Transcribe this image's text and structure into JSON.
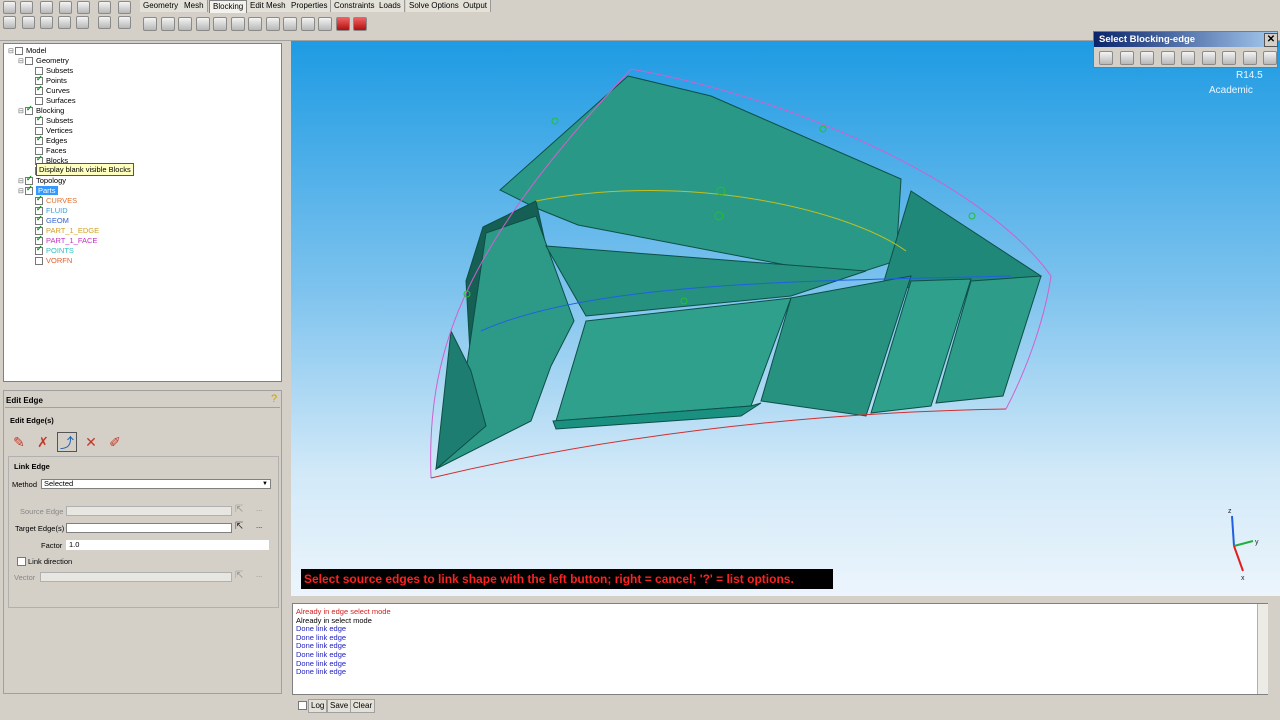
{
  "menu_tabs": [
    "Geometry",
    "Mesh",
    "Blocking",
    "Edit Mesh",
    "Properties",
    "Constraints",
    "Loads",
    "Solve Options",
    "Output"
  ],
  "active_tab": "Blocking",
  "tree": [
    {
      "label": "Model",
      "checked": false,
      "color": "#000000"
    },
    {
      "label": "Geometry",
      "checked": false,
      "color": "#000000"
    },
    {
      "label": "Subsets",
      "checked": false,
      "color": "#000000"
    },
    {
      "label": "Points",
      "checked": true,
      "color": "#000000"
    },
    {
      "label": "Curves",
      "checked": true,
      "color": "#000000"
    },
    {
      "label": "Surfaces",
      "checked": false,
      "color": "#000000"
    },
    {
      "label": "Blocking",
      "checked": true,
      "color": "#000000"
    },
    {
      "label": "Subsets",
      "checked": true,
      "color": "#000000"
    },
    {
      "label": "Vertices",
      "checked": false,
      "color": "#000000"
    },
    {
      "label": "Edges",
      "checked": true,
      "color": "#000000"
    },
    {
      "label": "Faces",
      "checked": false,
      "color": "#000000"
    },
    {
      "label": "Blocks",
      "checked": true,
      "color": "#000000"
    },
    {
      "label": "",
      "checked": false,
      "color": "#000000"
    },
    {
      "label": "Topology",
      "checked": true,
      "color": "#000000"
    },
    {
      "label": "Parts",
      "checked": true,
      "color": "#ffffff",
      "selected": true
    },
    {
      "label": "CURVES",
      "checked": true,
      "color": "#e07030"
    },
    {
      "label": "FLUID",
      "checked": true,
      "color": "#30a0e0"
    },
    {
      "label": "GEOM",
      "checked": true,
      "color": "#3060d0"
    },
    {
      "label": "PART_1_EDGE",
      "checked": true,
      "color": "#d0a020"
    },
    {
      "label": "PART_1_FACE",
      "checked": true,
      "color": "#c030c0"
    },
    {
      "label": "POINTS",
      "checked": true,
      "color": "#30c0c0"
    },
    {
      "label": "VORFN",
      "checked": false,
      "color": "#e06030"
    }
  ],
  "tooltip": "Display blank visible Blocks",
  "panel": {
    "title": "Edit Edge",
    "section": "Edit Edge(s)",
    "subsection": "Link Edge",
    "method_label": "Method",
    "method_value": "Selected",
    "source_label": "Source Edge",
    "target_label": "Target Edge(s)",
    "factor_label": "Factor",
    "factor_value": "1.0",
    "link_direction_label": "Link direction",
    "vector_label": "Vector",
    "dots": "..."
  },
  "select_dialog_title": "Select Blocking-edge",
  "version_label": "R14.5",
  "version_sub": "Academic",
  "status_message": "Select source edges to link shape with the left button; right = cancel; '?' = list options.",
  "log_lines": [
    {
      "text": "Already in edge select mode",
      "color": "#d02020"
    },
    {
      "text": "Already in select mode",
      "color": "#000000"
    },
    {
      "text": "Done link edge",
      "color": "#2020c0"
    },
    {
      "text": "Done link edge",
      "color": "#2020c0"
    },
    {
      "text": "Done link edge",
      "color": "#2020c0"
    },
    {
      "text": "Done link edge",
      "color": "#2020c0"
    },
    {
      "text": "Done link edge",
      "color": "#2020c0"
    },
    {
      "text": "Done link edge",
      "color": "#2020c0"
    }
  ],
  "log_buttons": {
    "log": "Log",
    "save": "Save",
    "clear": "Clear"
  },
  "axis_labels": {
    "z": "z",
    "y": "y",
    "x": "x"
  },
  "colors": {
    "mesh_fill": "#2a9886",
    "mesh_edge": "#0d4f47",
    "viewport_top": "#1e9be3",
    "status_text": "#ff2020"
  }
}
